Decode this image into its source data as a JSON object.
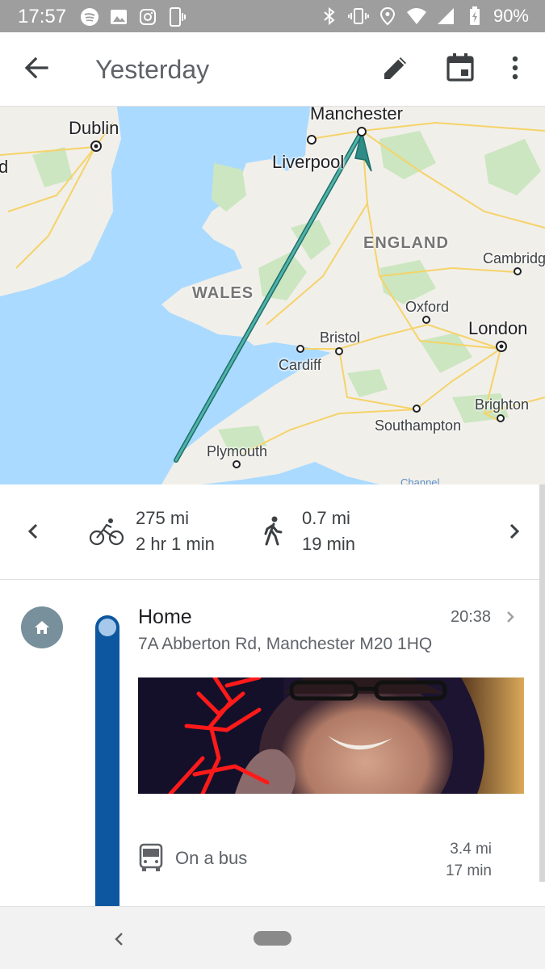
{
  "status_bar": {
    "time": "17:57",
    "battery": "90%",
    "left_icons": [
      "spotify-icon",
      "image-icon",
      "instagram-icon",
      "phone-vibrate-icon"
    ],
    "right_icons": [
      "bluetooth-icon",
      "vibrate-icon",
      "location-icon",
      "wifi-icon",
      "signal-icon",
      "battery-icon"
    ]
  },
  "app_bar": {
    "title": "Yesterday",
    "actions": [
      "back-arrow-icon",
      "pencil-icon",
      "calendar-icon",
      "more-vert-icon"
    ]
  },
  "map": {
    "labels": {
      "manchester": "Manchester",
      "dublin": "Dublin",
      "liverpool": "Liverpool",
      "england": "ENGLAND",
      "cambridge": "Cambridg",
      "wales": "WALES",
      "oxford": "Oxford",
      "london": "London",
      "bristol": "Bristol",
      "cardiff": "Cardiff",
      "brighton": "Brighton",
      "southampton": "Southampton",
      "plymouth": "Plymouth",
      "channel": "Channel",
      "edge": "d"
    },
    "route_color": "#2e8b85"
  },
  "summary": {
    "cycling": {
      "distance": "275 mi",
      "duration": "2 hr 1 min"
    },
    "walking": {
      "distance": "0.7 mi",
      "duration": "19 min"
    }
  },
  "timeline": {
    "place": {
      "name": "Home",
      "time": "20:38",
      "address": "7A Abberton Rd, Manchester M20 1HQ"
    },
    "transit": {
      "label": "On a bus",
      "distance": "3.4 mi",
      "duration": "17 min"
    },
    "track_color": "#0d57a0"
  }
}
